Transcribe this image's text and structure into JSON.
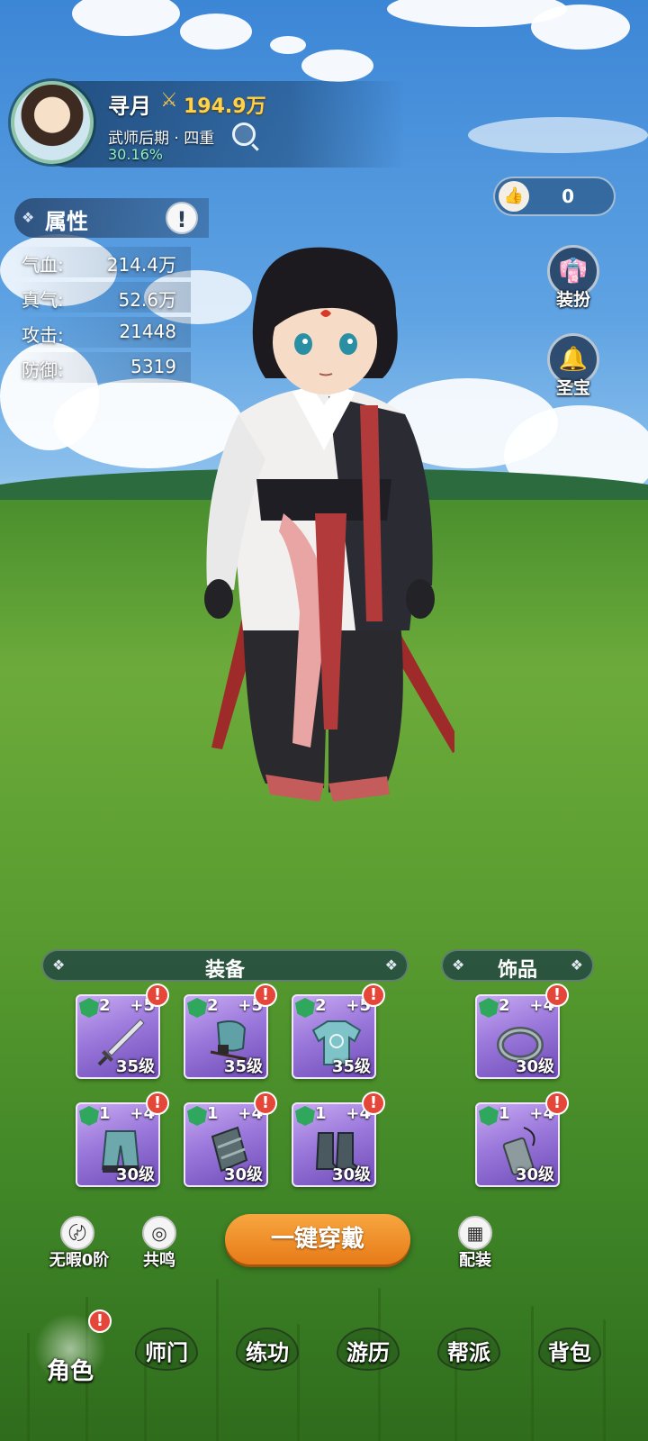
{
  "profile": {
    "name": "寻月",
    "power_icon": "crossed-swords-icon",
    "power": "194.9万",
    "realm": "武师后期 · 四重",
    "progress": "30.16%"
  },
  "likes": {
    "icon": "thumbs-up-icon",
    "count": "0"
  },
  "attributes": {
    "title": "属性",
    "info_icon": "!",
    "rows": [
      {
        "label": "气血:",
        "value": "214.4万"
      },
      {
        "label": "真气:",
        "value": "52.6万"
      },
      {
        "label": "攻击:",
        "value": "21448"
      },
      {
        "label": "防御:",
        "value": "5319"
      }
    ]
  },
  "side_buttons": {
    "outfit": {
      "label": "装扮",
      "icon": "robe-icon"
    },
    "treasure": {
      "label": "圣宝",
      "icon": "bell-icon"
    }
  },
  "equipment": {
    "title": "装备",
    "slots": [
      {
        "item": "sword",
        "grade": "2",
        "plus": "+5",
        "level": "35级",
        "alert": "!"
      },
      {
        "item": "helmet",
        "grade": "2",
        "plus": "+5",
        "level": "35级",
        "alert": "!"
      },
      {
        "item": "robe",
        "grade": "2",
        "plus": "+5",
        "level": "35级",
        "alert": "!"
      },
      {
        "item": "pants",
        "grade": "1",
        "plus": "+4",
        "level": "30级",
        "alert": "!"
      },
      {
        "item": "bracer",
        "grade": "1",
        "plus": "+4",
        "level": "30级",
        "alert": "!"
      },
      {
        "item": "boots",
        "grade": "1",
        "plus": "+4",
        "level": "30级",
        "alert": "!"
      }
    ]
  },
  "accessories": {
    "title": "饰品",
    "slots": [
      {
        "item": "ring",
        "grade": "2",
        "plus": "+4",
        "level": "30级",
        "alert": "!"
      },
      {
        "item": "pendant",
        "grade": "1",
        "plus": "+4",
        "level": "30级",
        "alert": "!"
      }
    ]
  },
  "actions": {
    "flawless": "无暇0阶",
    "resonance": "共鸣",
    "wear_all": "一键穿戴",
    "loadout": "配装"
  },
  "nav": {
    "role": "角色",
    "role_alert": "!",
    "sect": "师门",
    "train": "练功",
    "travel": "游历",
    "guild": "帮派",
    "bag": "背包"
  }
}
